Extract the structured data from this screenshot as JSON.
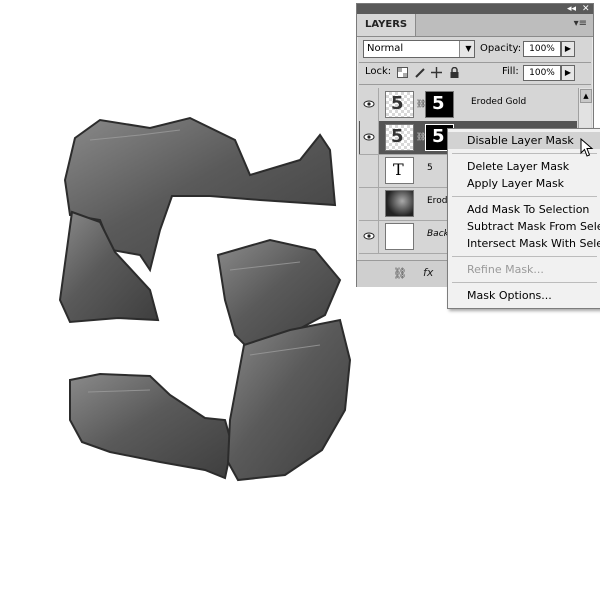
{
  "panel": {
    "tab_label": "LAYERS",
    "blend_mode": "Normal",
    "opacity_label": "Opacity:",
    "opacity_value": "100%",
    "lock_label": "Lock:",
    "fill_label": "Fill:",
    "fill_value": "100%",
    "layers": [
      {
        "name": "Eroded Gold",
        "visible": true,
        "selected": false
      },
      {
        "name": "",
        "visible": true,
        "selected": true
      },
      {
        "name": "5",
        "visible": false,
        "selected": false
      },
      {
        "name": "Erod",
        "visible": false,
        "selected": false
      },
      {
        "name": "Back",
        "visible": true,
        "selected": false
      }
    ],
    "thumb_glyph": "5",
    "type_glyph": "T"
  },
  "context_menu": {
    "items": [
      {
        "label": "Disable Layer Mask",
        "highlighted": true,
        "disabled": false
      },
      {
        "label": "Delete Layer Mask",
        "highlighted": false,
        "disabled": false
      },
      {
        "label": "Apply Layer Mask",
        "highlighted": false,
        "disabled": false
      },
      {
        "label": "Add Mask To Selection",
        "highlighted": false,
        "disabled": false
      },
      {
        "label": "Subtract Mask From Selection",
        "highlighted": false,
        "disabled": false
      },
      {
        "label": "Intersect Mask With Selection",
        "highlighted": false,
        "disabled": false
      },
      {
        "label": "Refine Mask...",
        "highlighted": false,
        "disabled": true
      },
      {
        "label": "Mask Options...",
        "highlighted": false,
        "disabled": false
      }
    ]
  },
  "colors": {
    "panel_bg": "#d6d6d6",
    "selected_row": "#555555",
    "menu_bg": "#f1f1f1",
    "highlight": "#d2d2d2",
    "artwork": "#5a5a5a"
  }
}
